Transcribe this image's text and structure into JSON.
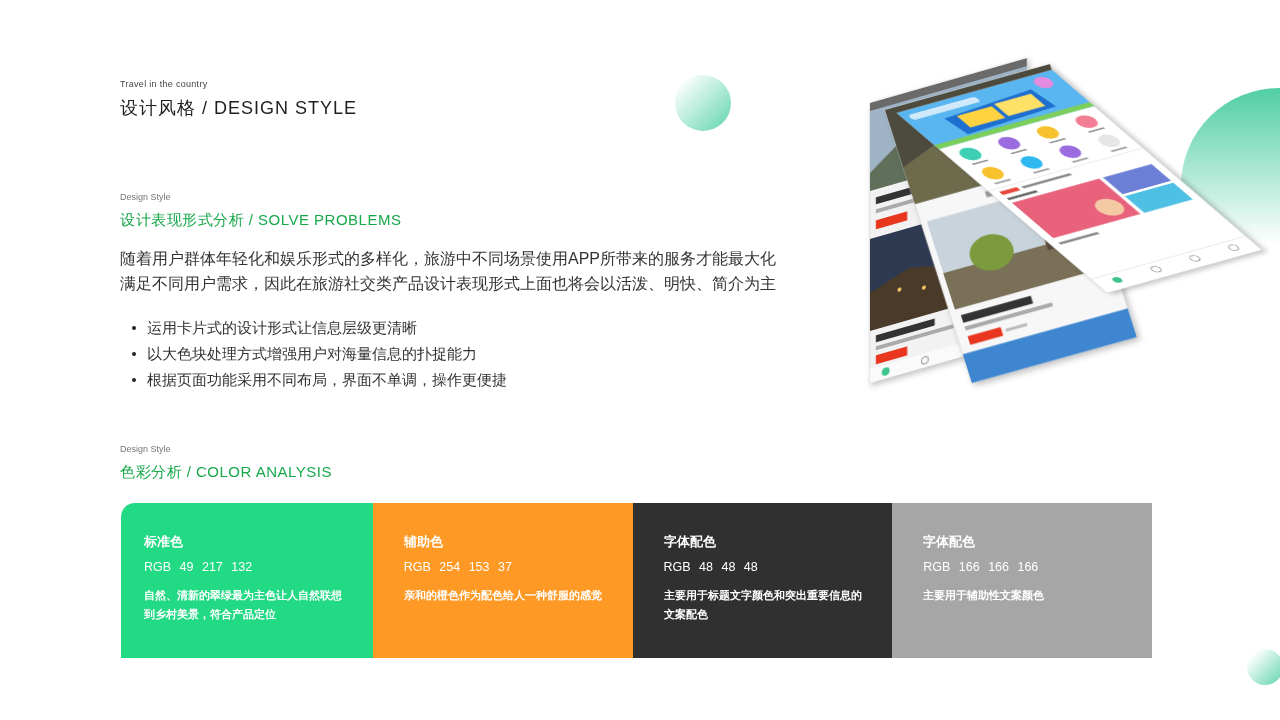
{
  "header": {
    "subtitle": "Travel in the country",
    "title": "设计风格 / DESIGN STYLE"
  },
  "solve_section": {
    "label": "Design Style",
    "title": "设计表现形式分析 / SOLVE PROBLEMS",
    "paragraph": "随着用户群体年轻化和娱乐形式的多样化，旅游中不同场景使用APP所带来的服务才能最大化满足不同用户需求，因此在旅游社交类产品设计表现形式上面也将会以活泼、明快、简介为主",
    "bullets": [
      "运用卡片式的设计形式让信息层级更清晰",
      "以大色块处理方式增强用户对海量信息的扑捉能力",
      "根据页面功能采用不同布局，界面不单调，操作更便捷"
    ]
  },
  "color_section": {
    "label": "Design Style",
    "title": "色彩分析 / COLOR ANALYSIS",
    "swatches": [
      {
        "name": "标准色",
        "rgb": "RGB 49 217 132",
        "description": "自然、清新的翠绿最为主色让人自然联想到乡村美景，符合产品定位",
        "color": "#22d984"
      },
      {
        "name": "辅助色",
        "rgb": "RGB 254 153 37",
        "description": "亲和的橙色作为配色给人一种舒服的感觉",
        "color": "#fe9925"
      },
      {
        "name": "字体配色",
        "rgb": "RGB 48 48 48",
        "description": "主要用于标题文字颜色和突出重要信息的文案配色",
        "color": "#303030"
      },
      {
        "name": "字体配色",
        "rgb": "RGB 166 166 166",
        "description": "主要用于辅助性文案颜色",
        "color": "#a6a6a6"
      }
    ]
  }
}
